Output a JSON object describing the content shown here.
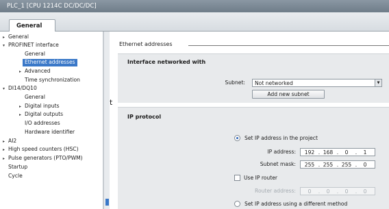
{
  "window": {
    "title": "PLC_1 [CPU 1214C DC/DC/DC]"
  },
  "tabs": [
    {
      "label": "General"
    }
  ],
  "nav": {
    "items": [
      {
        "label": "General",
        "arrow": "▸"
      },
      {
        "label": "PROFINET interface",
        "arrow": "▾"
      },
      {
        "label": "General",
        "arrow": ""
      },
      {
        "label": "Ethernet addresses",
        "arrow": "",
        "selected": true
      },
      {
        "label": "Advanced",
        "arrow": "▸"
      },
      {
        "label": "Time synchronization",
        "arrow": ""
      },
      {
        "label": "DI14/DQ10",
        "arrow": "▾"
      },
      {
        "label": "General",
        "arrow": ""
      },
      {
        "label": "Digital inputs",
        "arrow": "▸"
      },
      {
        "label": "Digital outputs",
        "arrow": "▸"
      },
      {
        "label": "I/O addresses",
        "arrow": ""
      },
      {
        "label": "Hardware identifier",
        "arrow": ""
      },
      {
        "label": "AI2",
        "arrow": "▸"
      },
      {
        "label": "High speed counters (HSC)",
        "arrow": "▸"
      },
      {
        "label": "Pulse generators (PTO/PWM)",
        "arrow": "▸"
      },
      {
        "label": "Startup",
        "arrow": ""
      },
      {
        "label": "Cycle",
        "arrow": ""
      }
    ]
  },
  "stray_text": "t",
  "content": {
    "section_title": "Ethernet addresses",
    "interface": {
      "title": "Interface networked with",
      "subnet_label": "Subnet:",
      "subnet_value": "Not networked",
      "add_subnet_label": "Add new subnet"
    },
    "ip_protocol": {
      "title": "IP protocol",
      "set_in_project_label": "Set IP address in the project",
      "ip_address_label": "IP address:",
      "ip_address": [
        "192",
        "168",
        "0",
        "1"
      ],
      "subnet_mask_label": "Subnet mask:",
      "subnet_mask": [
        "255",
        "255",
        "255",
        "0"
      ],
      "use_router_label": "Use IP router",
      "router_address_label": "Router address:",
      "router_address": [
        "0",
        "0",
        "0",
        "0"
      ],
      "different_method_label": "Set IP address using a different method"
    }
  }
}
